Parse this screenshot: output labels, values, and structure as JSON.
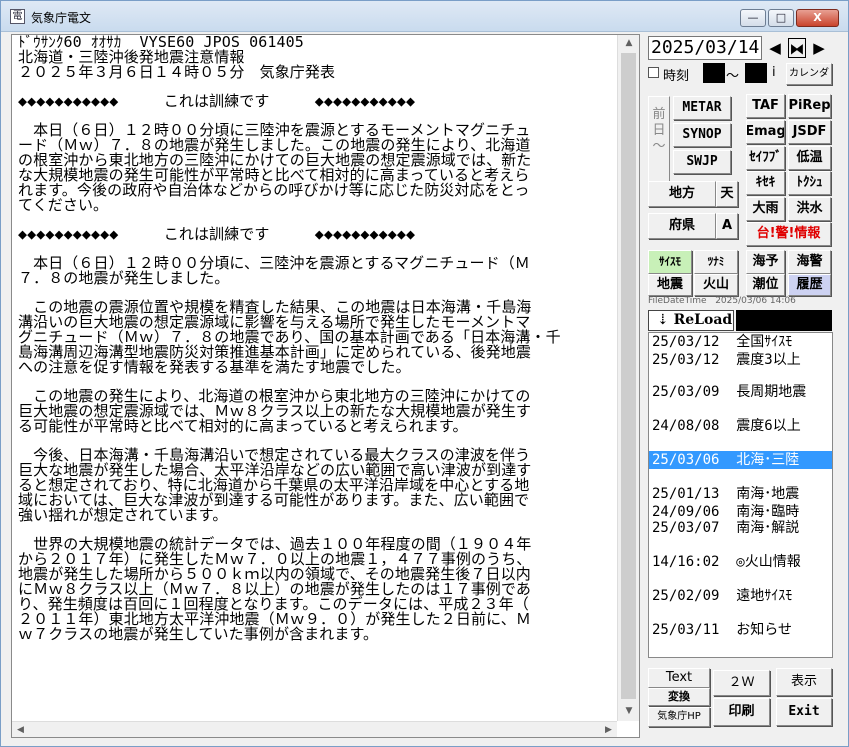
{
  "window": {
    "title": "気象庁電文",
    "icon_char": "電",
    "controls": {
      "minimize": "—",
      "maximize": "□",
      "close": "X"
    }
  },
  "document": {
    "header": [
      "ﾄﾞｳｻﾝｸ60 ｵｵｻｶ  VYSE60 JPOS 061405",
      "北海道・三陸沖後発地震注意情報",
      "２０２５年３月６日１４時０５分　気象庁発表"
    ],
    "blocks": [
      {
        "type": "banner",
        "text": "◆◆◆◆◆◆◆◆◆◆◆　　　これは訓練です　　　◆◆◆◆◆◆◆◆◆◆◆"
      },
      {
        "type": "para",
        "lines": [
          "　本日（６日）１２時００分頃に三陸沖を震源とするモーメントマグニチュ",
          "ード（Ｍｗ）７．８の地震が発生しました。この地震の発生により、北海道",
          "の根室沖から東北地方の三陸沖にかけての巨大地震の想定震源域では、新た",
          "な大規模地震の発生可能性が平常時と比べて相対的に高まっていると考えら",
          "れます。今後の政府や自治体などからの呼びかけ等に応じた防災対応をとっ",
          "てください。"
        ]
      },
      {
        "type": "banner",
        "text": "◆◆◆◆◆◆◆◆◆◆◆　　　これは訓練です　　　◆◆◆◆◆◆◆◆◆◆◆"
      },
      {
        "type": "para",
        "lines": [
          "　本日（６日）１２時００分頃に、三陸沖を震源とするマグニチュード（Ｍ",
          "７．８の地震が発生しました。"
        ]
      },
      {
        "type": "para",
        "lines": [
          "　この地震の震源位置や規模を精査した結果、この地震は日本海溝・千島海",
          "溝沿いの巨大地震の想定震源域に影響を与える場所で発生したモーメントマ",
          "グニチュード（Ｍｗ）７．８の地震であり、国の基本計画である「日本海溝・千",
          "島海溝周辺海溝型地震防災対策推進基本計画」に定められている、後発地震",
          "への注意を促す情報を発表する基準を満たす地震でした。"
        ]
      },
      {
        "type": "para",
        "lines": [
          "　この地震の発生により、北海道の根室沖から東北地方の三陸沖にかけての",
          "巨大地震の想定震源域では、Ｍｗ８クラス以上の新たな大規模地震が発生す",
          "る可能性が平常時と比べて相対的に高まっていると考えられます。"
        ]
      },
      {
        "type": "para",
        "lines": [
          "　今後、日本海溝・千島海溝沿いで想定されている最大クラスの津波を伴う",
          "巨大な地震が発生した場合、太平洋沿岸などの広い範囲で高い津波が到達す",
          "ると想定されており、特に北海道から千葉県の太平洋沿岸域を中心とする地",
          "域においては、巨大な津波が到達する可能性があります。また、広い範囲で",
          "強い揺れが想定されています。"
        ]
      },
      {
        "type": "para",
        "lines": [
          "　世界の大規模地震の統計データでは、過去１００年程度の間（１９０４年",
          "から２０１７年）に発生したＭｗ７．０以上の地震１，４７７事例のうち、",
          "地震が発生した場所から５００ｋｍ以内の領域で、その地震発生後７日以内",
          "にＭｗ８クラス以上（Ｍｗ７．８以上）の地震が発生したのは１７事例であ",
          "り、発生頻度は百回に１回程度となります。このデータには、平成２３年（",
          "２０１１年）東北地方太平洋沖地震（Ｍｗ９．０）が発生した２日前に、Ｍ",
          "ｗ７クラスの地震が発生していた事例が含まれます。"
        ]
      }
    ]
  },
  "sidebar": {
    "date": "2025/03/14",
    "nav": {
      "prev": "◀",
      "mid": "⧓",
      "next": "▶"
    },
    "jikoku_label": "時刻",
    "tilde": "〜",
    "i_label": "i",
    "calendar": "カレンダ",
    "zenkaku": "前\n日\n〜",
    "buttons": {
      "metar": "METAR",
      "taf": "TAF",
      "pirep": "PiRep",
      "synop": "SYNOP",
      "emag": "Emag",
      "jsdf": "JSDF",
      "swjp": "SWJP",
      "seifubu": "ｾｲﾌﾌﾞ",
      "teion": "低温",
      "chihou": "地方",
      "ten": "天",
      "kiseki": "ｷｾｷ",
      "tokushu": "ﾄｸｼｭ",
      "fuken": "府県",
      "a": "A",
      "ooame": "大雨",
      "kouzui": "洪水",
      "taikeijou": "台!警!情報",
      "saisumo": "ｻｲｽﾓ",
      "tsunami": "ﾂﾅﾐ",
      "kaiyou": "海予",
      "kaikei": "海警",
      "jishin": "地震",
      "kazan": "火山",
      "choui": "潮位",
      "rireki": "履歴",
      "text": "Text",
      "henkan": "変換",
      "jmahp": "気象庁HP",
      "twoW": "２Ｗ",
      "hyouji": "表示",
      "insatsu": "印刷",
      "exit": "Exit"
    },
    "filedatetime_label": "FileDateTime",
    "filedatetime_value": "2025/03/06 14:06",
    "reload": "⇣ ReLoad",
    "list": [
      {
        "date": "25/03/12",
        "label": "全国ｻｲｽﾓ"
      },
      {
        "date": "25/03/12",
        "label": "震度3以上"
      },
      {
        "date": "25/03/09",
        "label": "長周期地震"
      },
      {
        "date": "24/08/08",
        "label": "震度6以上"
      },
      {
        "date": "25/03/06",
        "label": "北海･三陸",
        "selected": true
      },
      {
        "date": "25/01/13",
        "label": "南海･地震"
      },
      {
        "date": "24/09/06",
        "label": "南海･臨時"
      },
      {
        "date": "25/03/07",
        "label": "南海･解説"
      },
      {
        "date": "14/16:02",
        "label": "◎火山情報"
      },
      {
        "date": "25/02/09",
        "label": "遠地ｻｲｽﾓ"
      },
      {
        "date": "25/03/11",
        "label": "お知らせ"
      }
    ]
  }
}
